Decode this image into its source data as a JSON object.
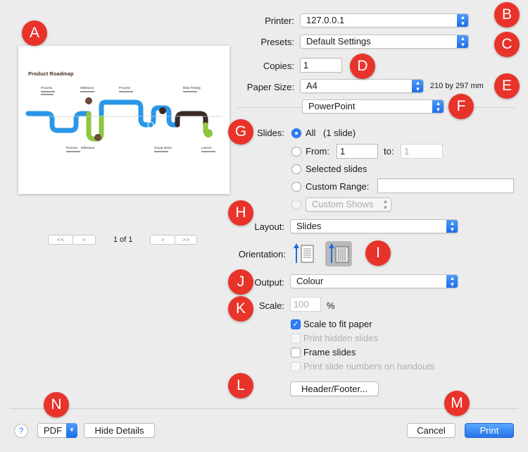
{
  "printer": {
    "label": "Printer:",
    "value": "127.0.0.1"
  },
  "presets": {
    "label": "Presets:",
    "value": "Default Settings"
  },
  "copies": {
    "label": "Copies:",
    "value": "1"
  },
  "paper": {
    "label": "Paper Size:",
    "value": "A4",
    "dimensions": "210 by 297 mm"
  },
  "section": {
    "value": "PowerPoint"
  },
  "slides": {
    "label": "Slides:",
    "all_label": "All",
    "all_count": "(1 slide)",
    "from_label": "From:",
    "from_value": "1",
    "to_label": "to:",
    "to_value": "1",
    "selected_label": "Selected slides",
    "custom_range_label": "Custom Range:",
    "custom_range_value": "",
    "custom_shows_label": "Custom Shows"
  },
  "layout": {
    "label": "Layout:",
    "value": "Slides"
  },
  "orientation": {
    "label": "Orientation:"
  },
  "output": {
    "label": "Output:",
    "value": "Colour"
  },
  "scale": {
    "label": "Scale:",
    "value": "100",
    "unit": "%"
  },
  "options": {
    "scale_to_fit": "Scale to fit paper",
    "print_hidden": "Print hidden slides",
    "frame_slides": "Frame slides",
    "print_numbers": "Print slide numbers on handouts"
  },
  "header_footer_label": "Header/Footer...",
  "pager": {
    "text": "1 of 1",
    "first": "<<",
    "prev": "<",
    "next": ">",
    "last": ">>"
  },
  "bottom": {
    "help": "?",
    "pdf": "PDF",
    "hide_details": "Hide Details",
    "cancel": "Cancel",
    "print": "Print"
  },
  "markers": [
    "A",
    "B",
    "C",
    "D",
    "E",
    "F",
    "G",
    "H",
    "I",
    "J",
    "K",
    "L",
    "M",
    "N"
  ],
  "preview": {
    "title": "Product Roadmap",
    "top_labels": [
      "Process",
      "Milestone",
      "Process",
      "Beta Testing"
    ],
    "bottom_labels": [
      "Process",
      "Milestone",
      "Group Items",
      "Launch"
    ]
  },
  "colors": {
    "accent": "#2f7cf6",
    "marker": "#e8332a",
    "blue_track": "#2a97e8",
    "green_track": "#8dc63f",
    "dark_track": "#3a2a25"
  }
}
